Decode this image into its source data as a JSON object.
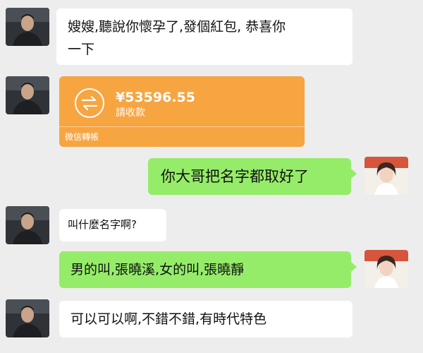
{
  "messages": [
    {
      "sender": "left",
      "text_line1": "嫂嫂,聽說你懷孕了,發個紅包, 恭喜你",
      "text_line2": "一下"
    },
    {
      "sender": "left",
      "type": "transfer",
      "amount": "¥53596.55",
      "action": "請收款",
      "footer": "微信轉帳"
    },
    {
      "sender": "right",
      "text": "你大哥把名字都取好了"
    },
    {
      "sender": "left",
      "text": "叫什麼名字啊?"
    },
    {
      "sender": "right",
      "text": "男的叫,張曉溪,女的叫,張曉靜"
    },
    {
      "sender": "left",
      "text": "可以可以啊,不錯不錯,有時代特色"
    }
  ],
  "colors": {
    "background": "#ededed",
    "bubble_self": "#95ec69",
    "bubble_other": "#ffffff",
    "transfer": "#f7a541"
  }
}
